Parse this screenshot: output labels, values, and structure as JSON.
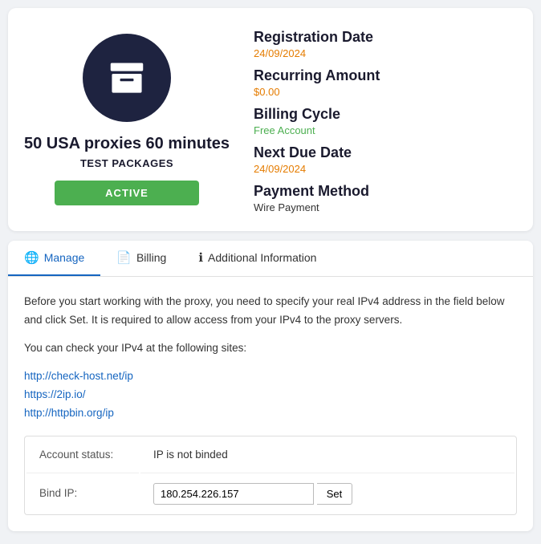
{
  "card": {
    "icon_label": "archive-box-icon",
    "title": "50 USA proxies 60 minutes",
    "subtitle": "TEST PACKAGES",
    "status_badge": "ACTIVE",
    "registration_label": "Registration Date",
    "registration_value": "24/09/2024",
    "recurring_label": "Recurring Amount",
    "recurring_value": "$0.00",
    "billing_label": "Billing Cycle",
    "billing_value": "Free Account",
    "next_due_label": "Next Due Date",
    "next_due_value": "24/09/2024",
    "payment_label": "Payment Method",
    "payment_value": "Wire Payment"
  },
  "tabs": [
    {
      "id": "manage",
      "icon": "🌐",
      "label": "Manage",
      "active": true
    },
    {
      "id": "billing",
      "icon": "📄",
      "label": "Billing",
      "active": false
    },
    {
      "id": "additional-info",
      "icon": "ℹ",
      "label": "Additional Information",
      "active": false
    }
  ],
  "manage_tab": {
    "description": "Before you start working with the proxy, you need to specify your real IPv4 address in the field below and click Set. It is required to allow access from your IPv4 to the proxy servers.",
    "links_intro": "You can check your IPv4 at the following sites:",
    "links": [
      {
        "url": "http://check-host.net/ip",
        "label": "http://check-host.net/ip"
      },
      {
        "url": "https://2ip.io/",
        "label": "https://2ip.io/"
      },
      {
        "url": "http://httpbin.org/ip",
        "label": "http://httpbin.org/ip"
      }
    ],
    "account_status_label": "Account status:",
    "account_status_value": "IP is not binded",
    "bind_ip_label": "Bind IP:",
    "bind_ip_value": "180.254.226.157",
    "set_button_label": "Set"
  }
}
